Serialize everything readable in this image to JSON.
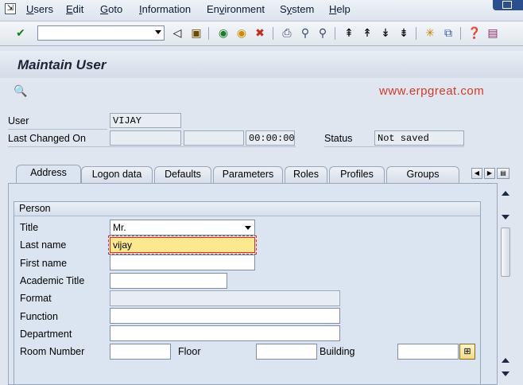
{
  "menu": {
    "items": [
      "Users",
      "Edit",
      "Goto",
      "Information",
      "Environment",
      "System",
      "Help"
    ],
    "underline": [
      "U",
      "E",
      "G",
      "I",
      "v",
      "y",
      "H"
    ]
  },
  "toolbar": {
    "command_placeholder": "",
    "icons": [
      "enter-icon",
      "back-icon",
      "save-icon",
      "back-green-icon",
      "exit-icon",
      "cancel-icon",
      "print-icon",
      "find-icon",
      "find-next-icon",
      "first-page-icon",
      "prev-page-icon",
      "next-page-icon",
      "last-page-icon",
      "create-session-icon",
      "shortcut-icon",
      "help-icon",
      "layout-icon"
    ]
  },
  "page": {
    "title": "Maintain User",
    "watermark": "www.erpgreat.com"
  },
  "header": {
    "user_label": "User",
    "user_value": "VIJAY",
    "last_changed_label": "Last Changed On",
    "last_changed_date": "",
    "last_changed_by": "",
    "last_changed_time": "00:00:00",
    "status_label": "Status",
    "status_value": "Not saved"
  },
  "tabs": [
    "Address",
    "Logon data",
    "Defaults",
    "Parameters",
    "Roles",
    "Profiles",
    "Groups"
  ],
  "active_tab": "Address",
  "person": {
    "group_title": "Person",
    "title_label": "Title",
    "title_value": "Mr.",
    "last_name_label": "Last name",
    "last_name_value": "vijay",
    "first_name_label": "First name",
    "first_name_value": "",
    "academic_title_label": "Academic Title",
    "academic_title_value": "",
    "format_label": "Format",
    "format_value": "",
    "function_label": "Function",
    "function_value": "",
    "department_label": "Department",
    "department_value": "",
    "room_label": "Room Number",
    "room_value": "",
    "floor_label": "Floor",
    "floor_value": "",
    "building_label": "Building",
    "building_value": ""
  },
  "colors": {
    "watermark": "#d33a2a",
    "required_highlight": "#fbe88f",
    "background": "#dfe6ef"
  }
}
